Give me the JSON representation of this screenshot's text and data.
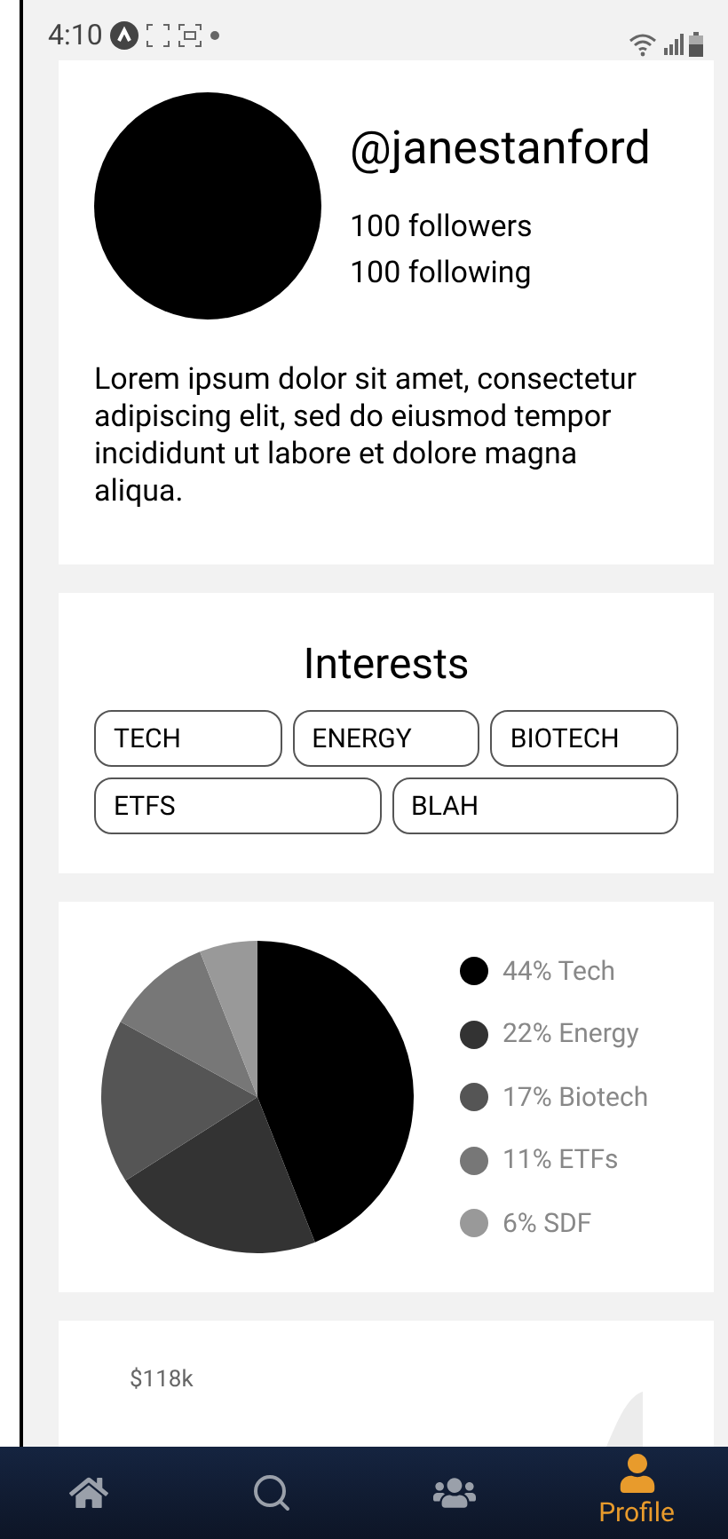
{
  "status_bar": {
    "time": "4:10"
  },
  "profile": {
    "username": "@janestanford",
    "followers": "100 followers",
    "following": "100 following",
    "bio": "Lorem ipsum dolor sit amet, consectetur adipiscing elit, sed do eiusmod tempor incididunt ut labore et dolore magna aliqua."
  },
  "interests": {
    "title": "Interests",
    "rows": [
      [
        "TECH",
        "ENERGY",
        "BIOTECH"
      ],
      [
        "ETFS",
        "BLAH"
      ]
    ]
  },
  "allocation": {
    "chart_data": {
      "type": "pie",
      "values": [
        44,
        22,
        17,
        11,
        6
      ]
    },
    "legend": [
      {
        "label": "44% Tech",
        "color": "#000000"
      },
      {
        "label": "22% Energy",
        "color": "#333333"
      },
      {
        "label": "17% Biotech",
        "color": "#555555"
      },
      {
        "label": "11% ETFs",
        "color": "#777777"
      },
      {
        "label": "6% SDF",
        "color": "#999999"
      }
    ]
  },
  "value_chart": {
    "y_label": "$118k"
  },
  "nav": [
    {
      "kind": "home",
      "selected": false
    },
    {
      "kind": "search",
      "selected": false
    },
    {
      "kind": "group",
      "selected": false
    },
    {
      "kind": "profile",
      "selected": true,
      "label": "Profile"
    }
  ]
}
